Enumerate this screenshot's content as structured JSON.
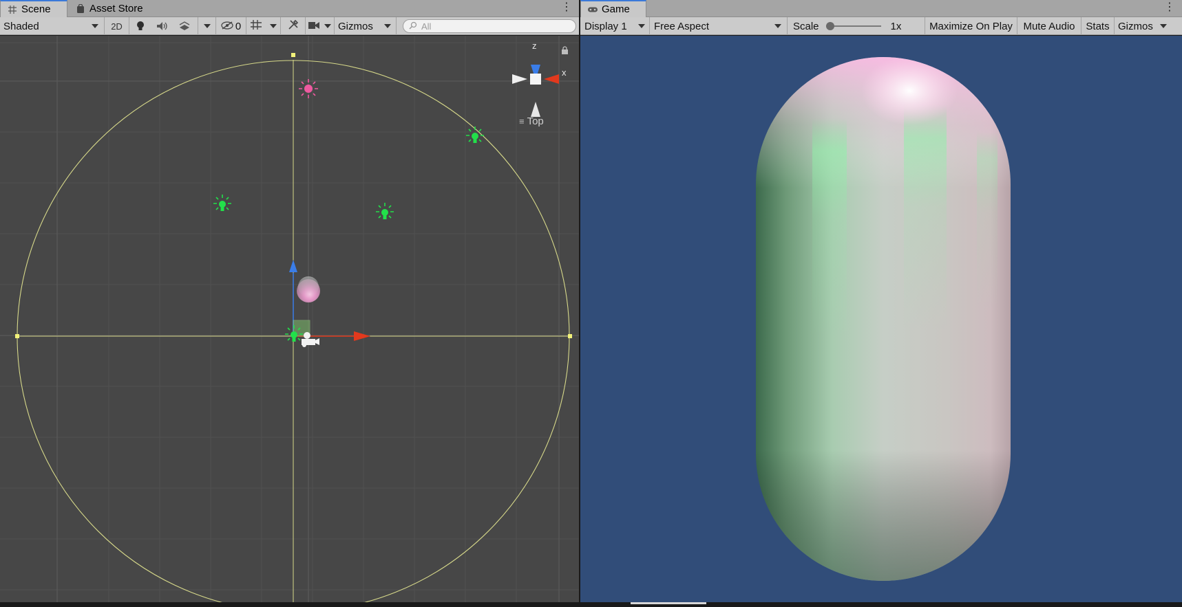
{
  "scene_panel": {
    "tabs": [
      {
        "label": "Scene",
        "icon": "grid-icon",
        "active": true
      },
      {
        "label": "Asset Store",
        "icon": "shopping-bag-icon",
        "active": false
      }
    ],
    "toolbar": {
      "draw_mode": "Shaded",
      "mode_2d": "2D",
      "hidden_count": "0",
      "gizmos_label": "Gizmos",
      "search_placeholder": "All"
    },
    "gizmo": {
      "axis_z": "z",
      "axis_x": "x",
      "view_label": "Top"
    }
  },
  "game_panel": {
    "tabs": [
      {
        "label": "Game",
        "icon": "gamepad-icon",
        "active": true
      }
    ],
    "toolbar": {
      "display": "Display 1",
      "aspect": "Free Aspect",
      "scale_label": "Scale",
      "scale_value": "1x",
      "maximize_on_play": "Maximize On Play",
      "mute_audio": "Mute Audio",
      "stats": "Stats",
      "gizmos": "Gizmos"
    }
  },
  "colors": {
    "scene_bg": "#474747",
    "game_bg": "#314d79",
    "light_gizmo": "#22e04a",
    "point_light_pink": "#ee5aa0",
    "range_circle": "#d7d98a",
    "axis_x_red": "#e2391d",
    "axis_z_blue": "#3a7de8",
    "tab_accent": "#3a79d9"
  }
}
